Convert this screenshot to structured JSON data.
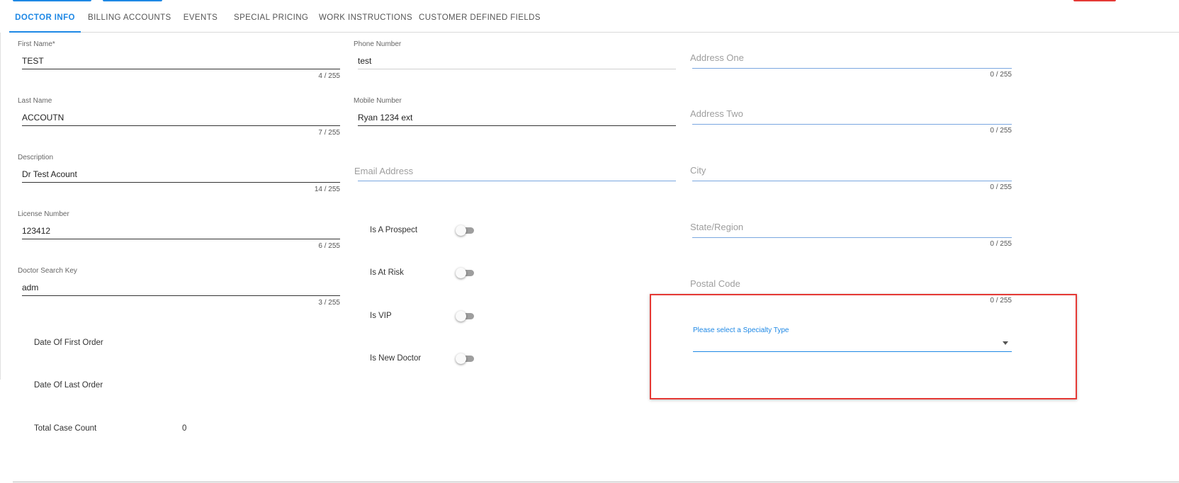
{
  "tabs": [
    {
      "label": "DOCTOR INFO",
      "active": true
    },
    {
      "label": "BILLING ACCOUNTS",
      "active": false
    },
    {
      "label": "EVENTS",
      "active": false
    },
    {
      "label": "SPECIAL PRICING",
      "active": false
    },
    {
      "label": "WORK INSTRUCTIONS",
      "active": false
    },
    {
      "label": "CUSTOMER DEFINED FIELDS",
      "active": false
    }
  ],
  "left_fields": {
    "first_name": {
      "label": "First Name",
      "required": "*",
      "value": "TEST",
      "counter": "4 / 255"
    },
    "last_name": {
      "label": "Last Name",
      "value": "ACCOUTN",
      "counter": "7 / 255"
    },
    "description": {
      "label": "Description",
      "value": "Dr Test Acount",
      "counter": "14 / 255"
    },
    "license_number": {
      "label": "License Number",
      "value": "123412",
      "counter": "6 / 255"
    },
    "doctor_search_key": {
      "label": "Doctor Search Key",
      "value": "adm",
      "counter": "3 / 255"
    }
  },
  "middle_fields": {
    "phone_number": {
      "label": "Phone Number",
      "value": "test"
    },
    "mobile_number": {
      "label": "Mobile Number",
      "value": "Ryan 1234 ext"
    },
    "email_address": {
      "placeholder": "Email Address"
    }
  },
  "toggles": [
    {
      "label": "Is A Prospect",
      "on": false
    },
    {
      "label": "Is At Risk",
      "on": false
    },
    {
      "label": "Is VIP",
      "on": false
    },
    {
      "label": "Is New Doctor",
      "on": false
    }
  ],
  "right_fields": {
    "address_one": {
      "placeholder": "Address One",
      "counter": "0 / 255"
    },
    "address_two": {
      "placeholder": "Address Two",
      "counter": "0 / 255"
    },
    "city": {
      "placeholder": "City",
      "counter": "0 / 255"
    },
    "state_region": {
      "placeholder": "State/Region",
      "counter": "0 / 255"
    },
    "postal_code": {
      "placeholder": "Postal Code",
      "counter": "0 / 255"
    }
  },
  "specialty_select": {
    "label": "Please select a Specialty Type",
    "value": ""
  },
  "stats": {
    "date_first_order_label": "Date Of First Order",
    "date_last_order_label": "Date Of Last Order",
    "total_case_count_label": "Total Case Count",
    "total_case_count_value": "0"
  },
  "colors": {
    "accent": "#1e88e5",
    "highlight": "#e53935"
  }
}
